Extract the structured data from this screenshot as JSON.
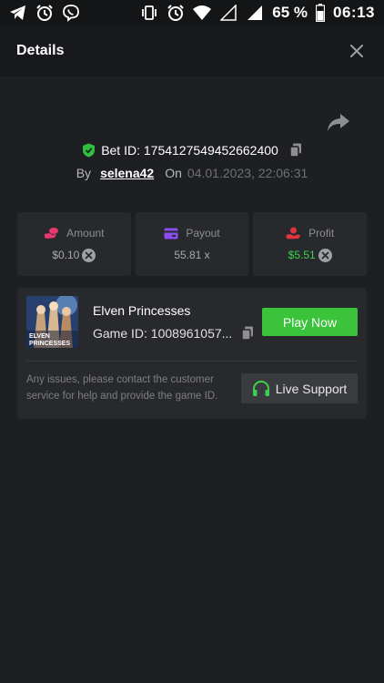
{
  "status_bar": {
    "battery_percent": "65 %",
    "time": "06:13",
    "icons": [
      "telegram-icon",
      "alarm-icon",
      "viber-icon",
      "vibrate-icon",
      "alarm-icon",
      "wifi-icon",
      "signal-empty-icon",
      "signal-icon",
      "battery-icon"
    ]
  },
  "header": {
    "title": "Details",
    "close_icon": "close-icon"
  },
  "bet": {
    "id_label": "Bet ID: 1754127549452662400",
    "by_label": "By",
    "username": "selena42",
    "on_label": "On",
    "datetime": "04.01.2023, 22:06:31"
  },
  "stats": {
    "amount": {
      "label": "Amount",
      "value": "$0.10",
      "icon": "coins-icon"
    },
    "payout": {
      "label": "Payout",
      "value": "55.81 x",
      "icon": "card-icon"
    },
    "profit": {
      "label": "Profit",
      "value": "$5.51",
      "icon": "hand-coin-icon"
    }
  },
  "game": {
    "name": "Elven Princesses",
    "id_label": "Game ID: 1008961057...",
    "play_label": "Play Now",
    "help_text": "Any issues, please contact the customer service for help and provide the game ID.",
    "support_label": "Live Support",
    "thumb_title_top": "ELVEN",
    "thumb_title_bottom": "PRINCESSES"
  },
  "colors": {
    "background": "#1e1f22",
    "card": "#28292d",
    "accent_green": "#3ac33b",
    "profit_green": "#3bd14d",
    "amount_icon": "#e8366f",
    "payout_icon": "#8a4df0",
    "profit_icon": "#e0353b"
  }
}
